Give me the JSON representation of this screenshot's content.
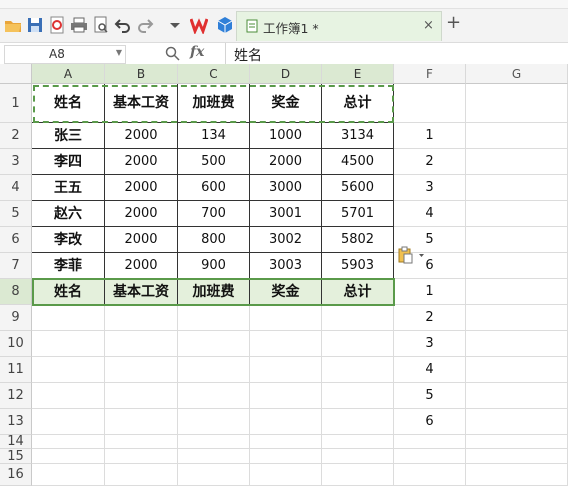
{
  "toolbar": {
    "icons": [
      "open-folder-icon",
      "save-icon",
      "export-pdf-icon",
      "print-icon",
      "print-preview-icon",
      "undo-icon",
      "redo-icon",
      "dropdown-icon",
      "wps-logo-icon",
      "cube-icon"
    ],
    "tab": {
      "label": "工作簿1 *",
      "close": "×"
    },
    "new_tab": "+"
  },
  "formula_bar": {
    "cell_ref": "A8",
    "fx_label": "fx",
    "value": "姓名"
  },
  "columns": [
    "A",
    "B",
    "C",
    "D",
    "E",
    "F",
    "G"
  ],
  "rows": [
    "1",
    "2",
    "3",
    "4",
    "5",
    "6",
    "7",
    "8",
    "9",
    "10",
    "11",
    "12",
    "13",
    "14",
    "15",
    "16"
  ],
  "table": {
    "headers": [
      "姓名",
      "基本工资",
      "加班费",
      "奖金",
      "总计"
    ],
    "data": [
      [
        "张三",
        "2000",
        "134",
        "1000",
        "3134"
      ],
      [
        "李四",
        "2000",
        "500",
        "2000",
        "4500"
      ],
      [
        "王五",
        "2000",
        "600",
        "3000",
        "5600"
      ],
      [
        "赵六",
        "2000",
        "700",
        "3001",
        "5701"
      ],
      [
        "李改",
        "2000",
        "800",
        "3002",
        "5802"
      ],
      [
        "李菲",
        "2000",
        "900",
        "3003",
        "5903"
      ]
    ],
    "row8": [
      "姓名",
      "基本工资",
      "加班费",
      "奖金",
      "总计"
    ]
  },
  "col_f": [
    "1",
    "2",
    "3",
    "4",
    "5",
    "6",
    "1",
    "2",
    "3",
    "4",
    "5",
    "6"
  ],
  "accent": "#5a9a4a",
  "selection_fill": "#e4f0dc"
}
